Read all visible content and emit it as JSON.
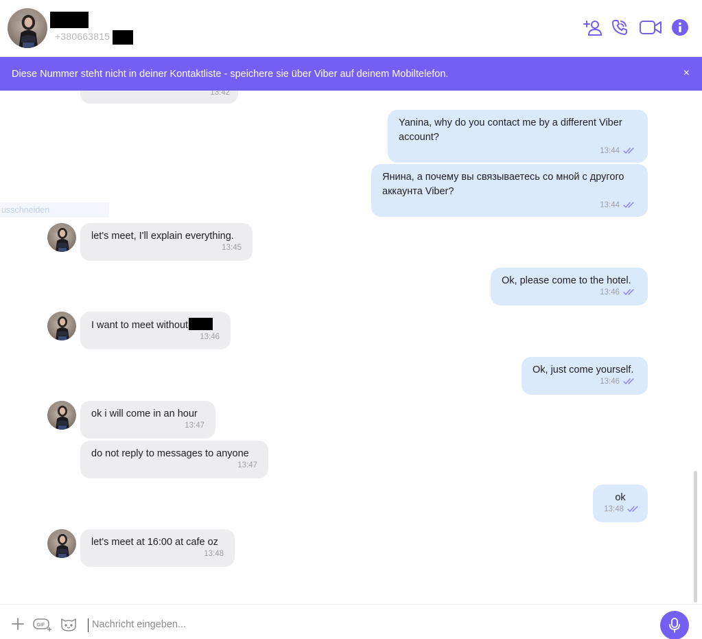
{
  "header": {
    "contact_name": "redacted",
    "phone": "+380663815",
    "icons": [
      "add-contact-icon",
      "voice-call-icon",
      "video-call-icon",
      "info-icon"
    ]
  },
  "banner": {
    "text": "Diese Nummer steht nicht in deiner Kontaktliste - speichere sie über Viber auf deinem Mobiltelefon.",
    "close": "×"
  },
  "chat": {
    "top_partial_time": "13:42",
    "hint_text": "usschneiden",
    "messages": [
      {
        "dir": "out",
        "text": "Yanina, why do you contact me by a different Viber account?",
        "time": "13:44"
      },
      {
        "dir": "out",
        "text": "Янина, а почему вы связываетесь со мной с другого аккаунта Viber?",
        "time": "13:44"
      },
      {
        "dir": "in",
        "text": "let's meet, I'll explain everything.",
        "time": "13:45"
      },
      {
        "dir": "out",
        "text": "Ok, please come to the hotel.",
        "time": "13:46"
      },
      {
        "dir": "in",
        "text": "I want to meet without",
        "time": "13:46",
        "redacted_tail": true
      },
      {
        "dir": "out",
        "text": "Ok, just come yourself.",
        "time": "13:46"
      },
      {
        "dir": "in",
        "text": "ok i will come in an hour",
        "time": "13:47"
      },
      {
        "dir": "in",
        "text": "do not reply to messages to anyone",
        "time": "13:47"
      },
      {
        "dir": "out",
        "text": "ok",
        "time": "13:48"
      },
      {
        "dir": "in",
        "text": "let's meet at 16:00 at cafe oz",
        "time": "13:48"
      }
    ]
  },
  "composer": {
    "placeholder": "Nachricht eingeben...",
    "icons": [
      "plus-icon",
      "gif-icon",
      "sticker-icon",
      "microphone-icon"
    ]
  },
  "colors": {
    "accent": "#7360f2",
    "incoming_bubble": "#ededf0",
    "outgoing_bubble": "#dbe9fd",
    "read_ticks": "#8c7cf4"
  }
}
